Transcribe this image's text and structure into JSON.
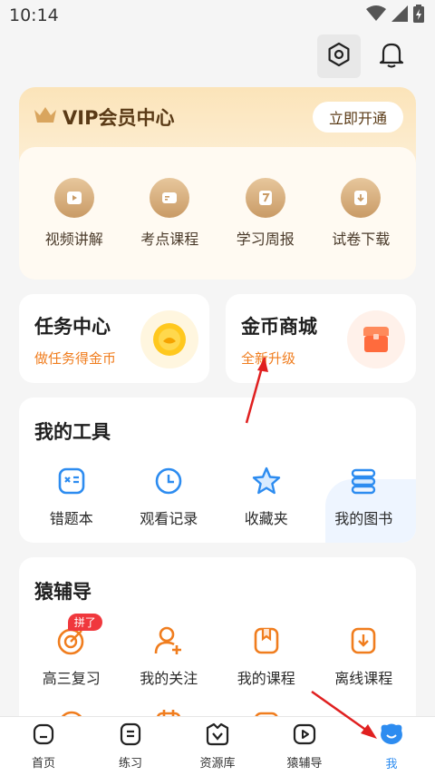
{
  "status": {
    "time": "10:14",
    "icons": [
      "wifi-icon",
      "signal-icon",
      "battery-icon"
    ]
  },
  "top_actions": {
    "icons": [
      "settings-icon",
      "bell-icon"
    ]
  },
  "vip": {
    "title": "VIP会员中心",
    "open_button": "立即开通",
    "items": [
      {
        "label": "视频讲解",
        "icon": "video-icon"
      },
      {
        "label": "考点课程",
        "icon": "card-icon"
      },
      {
        "label": "学习周报",
        "icon": "report-7-icon"
      },
      {
        "label": "试卷下载",
        "icon": "download-icon"
      }
    ]
  },
  "task": {
    "title": "任务中心",
    "subtitle": "做任务得金币",
    "icon": "coin-icon"
  },
  "shop": {
    "title": "金币商城",
    "subtitle": "全新升级",
    "icon": "shop-icon"
  },
  "tools": {
    "title": "我的工具",
    "items": [
      {
        "label": "错题本",
        "icon": "mistake-book-icon"
      },
      {
        "label": "观看记录",
        "icon": "clock-icon"
      },
      {
        "label": "收藏夹",
        "icon": "star-icon"
      },
      {
        "label": "我的图书",
        "icon": "books-icon"
      }
    ]
  },
  "fudao": {
    "title": "猿辅导",
    "badge": "拼了",
    "items": [
      {
        "label": "高三复习",
        "icon": "target-icon"
      },
      {
        "label": "我的关注",
        "icon": "follow-user-icon"
      },
      {
        "label": "我的课程",
        "icon": "bookmark-course-icon"
      },
      {
        "label": "离线课程",
        "icon": "offline-download-icon"
      }
    ]
  },
  "tabs": [
    {
      "label": "首页",
      "icon": "home-icon",
      "active": false
    },
    {
      "label": "练习",
      "icon": "practice-icon",
      "active": false
    },
    {
      "label": "资源库",
      "icon": "resource-icon",
      "active": false
    },
    {
      "label": "猿辅导",
      "icon": "play-icon",
      "active": false
    },
    {
      "label": "我",
      "icon": "me-icon",
      "active": true
    }
  ],
  "colors": {
    "accent_orange": "#f07d1e",
    "accent_blue": "#2d8cf0",
    "vip_brown": "#5a3a16",
    "badge_red": "#f0383d",
    "arrow_red": "#e02020"
  }
}
